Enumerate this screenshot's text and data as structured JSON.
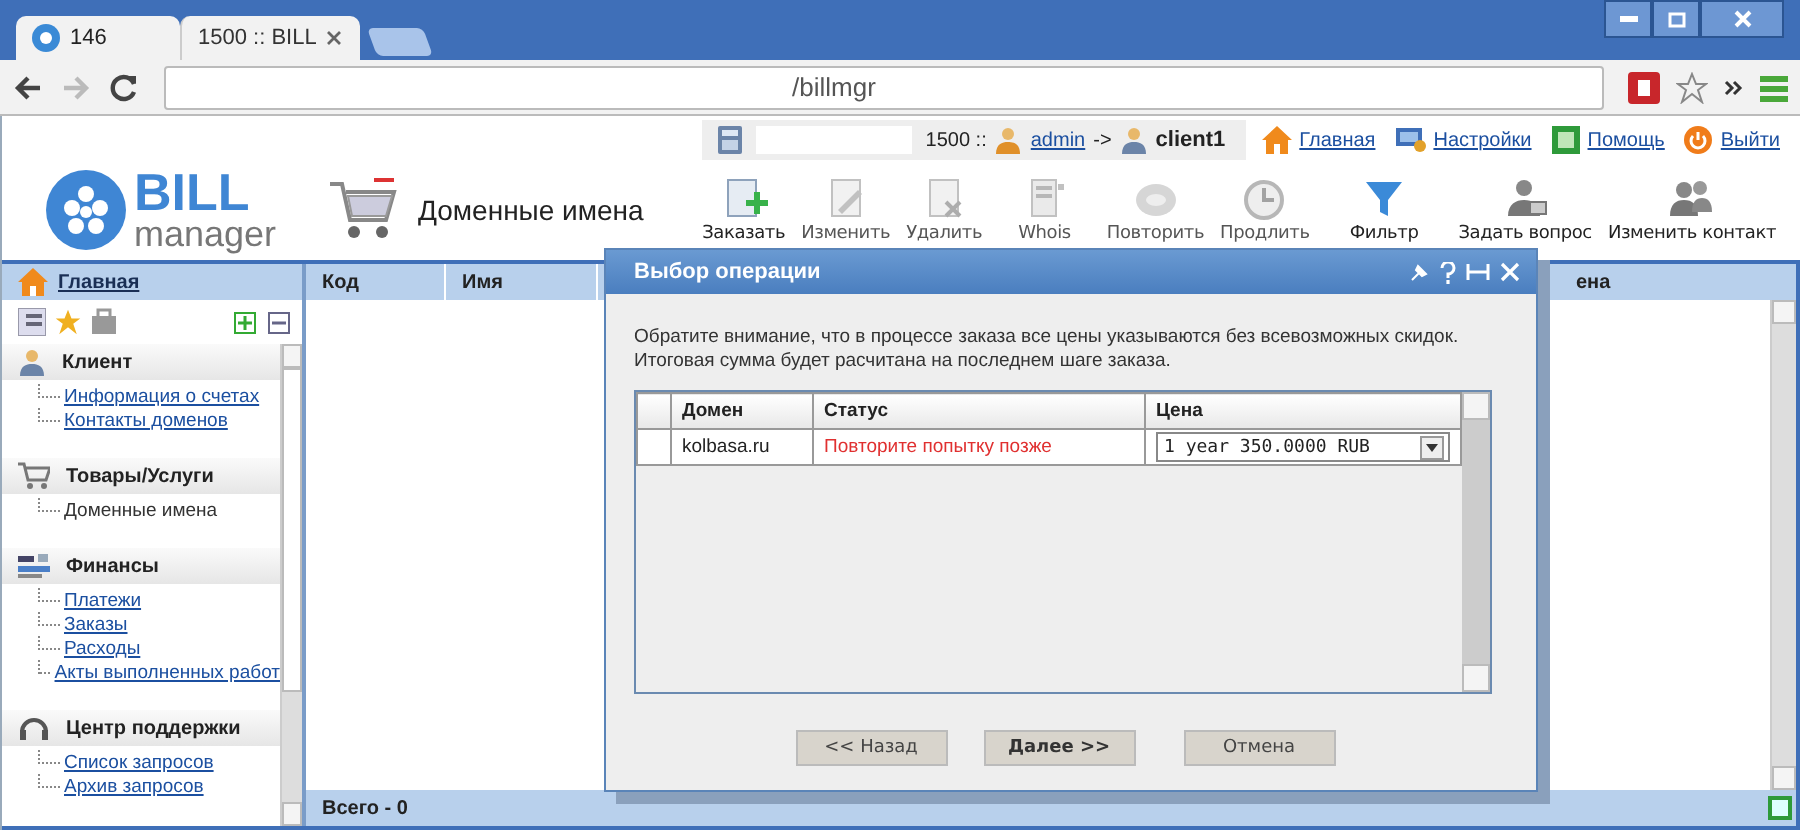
{
  "browser": {
    "tabs": [
      {
        "label": "146",
        "selected": true
      },
      {
        "label": "1500 :: BILL",
        "selected": false
      }
    ],
    "address": "/billmgr"
  },
  "top_bar": {
    "session": "1500 ::",
    "user": "admin",
    "arrow": "->",
    "client": "client1",
    "links": [
      "Главная",
      "Настройки",
      "Помощь",
      "Выйти"
    ]
  },
  "header": {
    "logo_top": "BILL",
    "logo_bottom": "manager",
    "title": "Доменные имена"
  },
  "toolbar": [
    {
      "label": "Заказать",
      "disabled": false
    },
    {
      "label": "Изменить",
      "disabled": true
    },
    {
      "label": "Удалить",
      "disabled": true
    },
    {
      "label": "Whois",
      "disabled": true
    },
    {
      "label": "Повторить",
      "disabled": true
    },
    {
      "label": "Продлить",
      "disabled": true
    },
    {
      "label": "Фильтр",
      "disabled": false
    },
    {
      "label": "Задать вопрос",
      "disabled": false
    },
    {
      "label": "Изменить контакт",
      "disabled": false
    }
  ],
  "sidebar": {
    "home": "Главная",
    "groups": [
      {
        "title": "Клиент",
        "items": [
          "Информация о счетах",
          "Контакты доменов"
        ]
      },
      {
        "title": "Товары/Услуги",
        "items": [
          "Доменные имена"
        ]
      },
      {
        "title": "Финансы",
        "items": [
          "Платежи",
          "Заказы",
          "Расходы",
          "Акты выполненных работ"
        ]
      },
      {
        "title": "Центр поддержки",
        "items": [
          "Список запросов",
          "Архив запросов"
        ]
      }
    ]
  },
  "list": {
    "columns": [
      "Код",
      "Имя",
      "ена"
    ],
    "footer": "Всего - 0"
  },
  "dialog": {
    "title": "Выбор операции",
    "note": "Обратите внимание, что в процессе заказа все цены указываются без всевозможных скидок. Итоговая сумма будет расчитана на последнем шаге заказа.",
    "columns": [
      "Домен",
      "Статус",
      "Цена"
    ],
    "rows": [
      {
        "domain": "kolbasa.ru",
        "status": "Повторите попытку позже",
        "price": "1 year 350.0000 RUB"
      }
    ],
    "buttons": [
      {
        "label": "<< Назад",
        "primary": false
      },
      {
        "label": "Далее >>",
        "primary": true
      },
      {
        "label": "Отмена",
        "primary": false
      }
    ]
  }
}
